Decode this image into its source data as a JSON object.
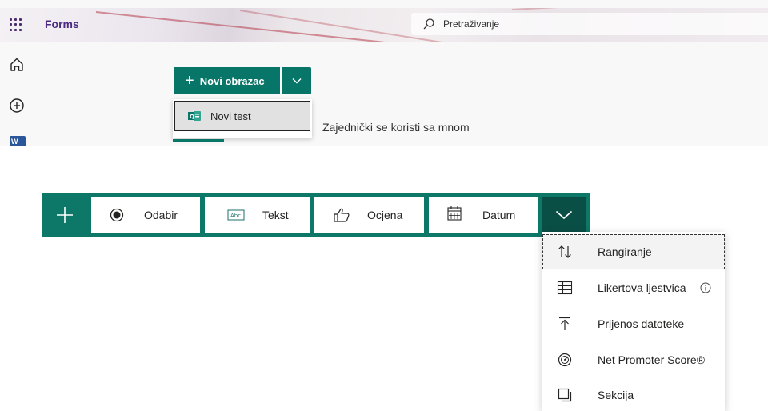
{
  "header": {
    "app_name": "Forms",
    "search_placeholder": "Pretraživanje",
    "icons": [
      "app-launcher-icon",
      "search-icon"
    ]
  },
  "left_rail": {
    "icons": [
      "home-icon",
      "add-circle-icon",
      "word-icon"
    ],
    "word_badge": "W"
  },
  "new_form": {
    "button_label": "Novi obrazac",
    "menu": [
      {
        "label": "Novi test",
        "icon": "quiz-icon"
      }
    ]
  },
  "tabs": {
    "shared_label": "Zajednički se koristi sa mnom"
  },
  "question_bar": {
    "types": [
      {
        "label": "Odabir",
        "icon": "radio-button-icon"
      },
      {
        "label": "Tekst",
        "icon": "text-box-icon"
      },
      {
        "label": "Ocjena",
        "icon": "thumbs-up-icon"
      },
      {
        "label": "Datum",
        "icon": "calendar-icon"
      }
    ],
    "more_icon": "chevron-down-icon",
    "add_icon": "plus-icon"
  },
  "more_menu": {
    "items": [
      {
        "label": "Rangiranje",
        "icon": "ranking-icon"
      },
      {
        "label": "Likertova ljestvica",
        "icon": "likert-grid-icon"
      },
      {
        "label": "Prijenos datoteke",
        "icon": "upload-icon"
      },
      {
        "label": "Net Promoter Score®",
        "icon": "gauge-icon"
      },
      {
        "label": "Sekcija",
        "icon": "section-icon"
      }
    ]
  },
  "colors": {
    "brand_purple": "#4b2a80",
    "teal": "#077568",
    "teal_bar": "#0d7868",
    "teal_dark": "#0a4f45"
  }
}
